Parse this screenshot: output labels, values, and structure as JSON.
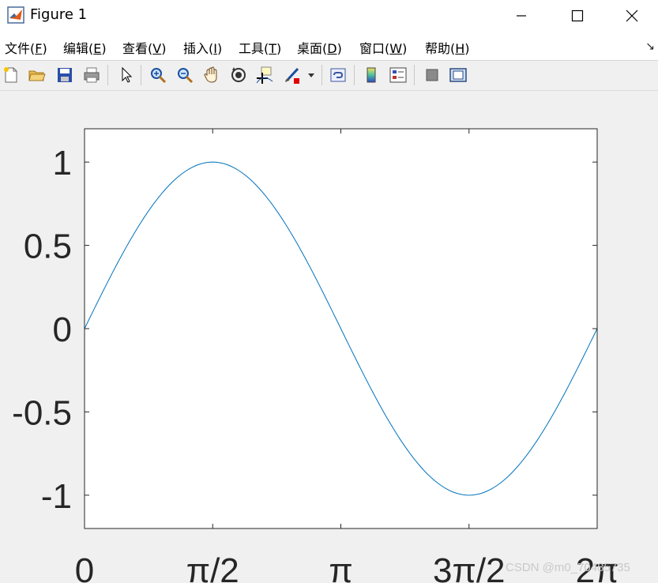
{
  "window": {
    "title": "Figure 1",
    "controls": [
      "minimize",
      "maximize",
      "close"
    ]
  },
  "menu": {
    "items": [
      {
        "label": "文件(",
        "key": "F",
        "tail": ")"
      },
      {
        "label": "编辑(",
        "key": "E",
        "tail": ")"
      },
      {
        "label": "查看(",
        "key": "V",
        "tail": ")"
      },
      {
        "label": "插入(",
        "key": "I",
        "tail": ")"
      },
      {
        "label": "工具(",
        "key": "T",
        "tail": ")"
      },
      {
        "label": "桌面(",
        "key": "D",
        "tail": ")"
      },
      {
        "label": "窗口(",
        "key": "W",
        "tail": ")"
      },
      {
        "label": "帮助(",
        "key": "H",
        "tail": ")"
      }
    ],
    "dock_arrow": "↘"
  },
  "toolbar": {
    "buttons": [
      "new-figure-icon",
      "open-file-icon",
      "save-icon",
      "print-icon",
      "edit-plot-arrow-icon",
      "zoom-in-icon",
      "zoom-out-icon",
      "pan-hand-icon",
      "rotate-3d-icon",
      "data-cursor-icon",
      "brush-icon",
      "link-plot-icon",
      "insert-colorbar-icon",
      "insert-legend-icon",
      "hide-plot-tools-icon",
      "show-plot-tools-icon"
    ]
  },
  "watermark": "CSDN @m0_70485735",
  "chart_data": {
    "type": "line",
    "function": "sin(x)",
    "x_range": [
      0,
      6.283185307
    ],
    "xlim": [
      0,
      6.283185307
    ],
    "ylim": [
      -1.2,
      1.2
    ],
    "x_ticks": [
      0,
      1.570796327,
      3.141592654,
      4.71238898,
      6.283185307
    ],
    "x_tick_labels": [
      "0",
      "π/2",
      "π",
      "3π/2",
      "2π"
    ],
    "y_ticks": [
      -1,
      -0.5,
      0,
      0.5,
      1
    ],
    "y_tick_labels": [
      "-1",
      "-0.5",
      "0",
      "0.5",
      "1"
    ],
    "series": [
      {
        "x": [
          0,
          0.3927,
          0.7854,
          1.1781,
          1.5708,
          1.9635,
          2.3562,
          2.7489,
          3.1416,
          3.5343,
          3.927,
          4.3197,
          4.7124,
          5.1051,
          5.4978,
          5.8905,
          6.2832
        ],
        "y": [
          0,
          0.3827,
          0.7071,
          0.9239,
          1,
          0.9239,
          0.7071,
          0.3827,
          0,
          -0.3827,
          -0.7071,
          -0.9239,
          -1,
          -0.9239,
          -0.7071,
          -0.3827,
          0
        ],
        "color": "#0072BD"
      }
    ],
    "grid": false,
    "title": "",
    "xlabel": "",
    "ylabel": ""
  }
}
